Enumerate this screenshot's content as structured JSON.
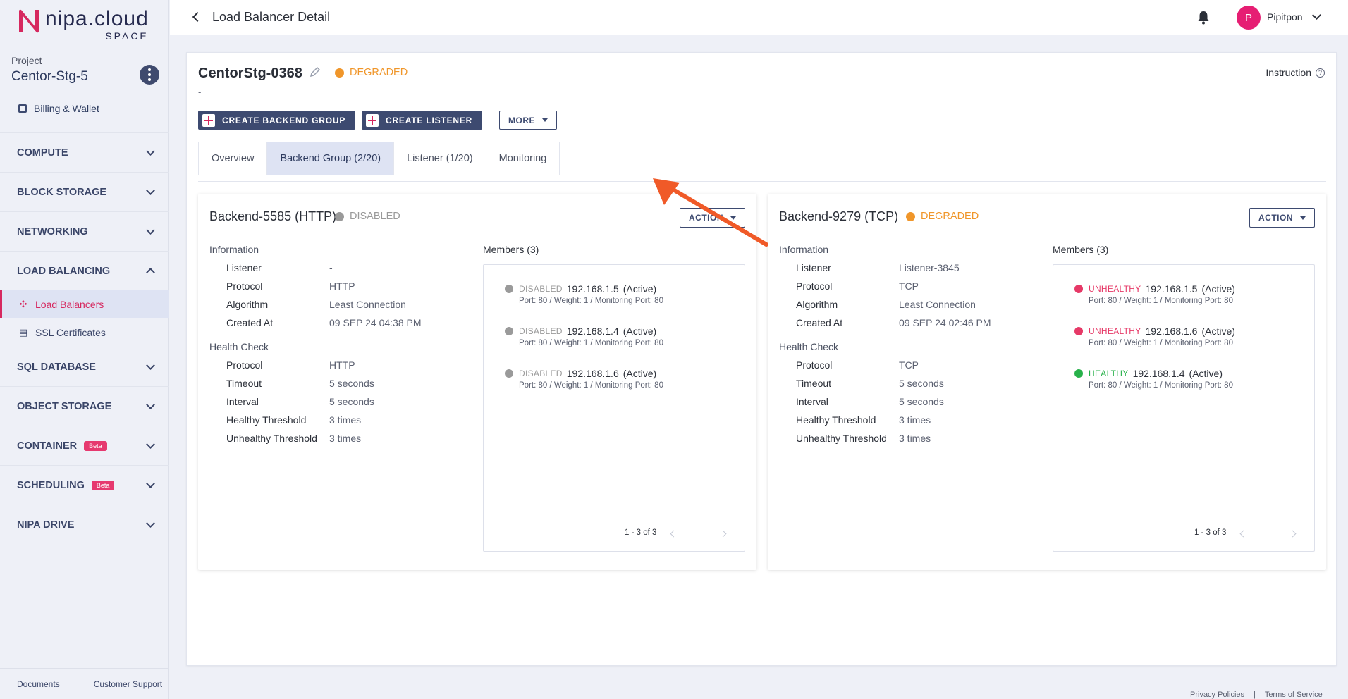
{
  "brand": {
    "name": "nipa.cloud",
    "sub": "SPACE",
    "logo_color": "#d6285f"
  },
  "project": {
    "label": "Project",
    "name": "Centor-Stg-5"
  },
  "billing": "Billing & Wallet",
  "nav": {
    "compute": "COMPUTE",
    "block_storage": "BLOCK STORAGE",
    "networking": "NETWORKING",
    "load_balancing": "LOAD BALANCING",
    "load_balancers": "Load Balancers",
    "ssl_certificates": "SSL Certificates",
    "sql_database": "SQL DATABASE",
    "object_storage": "OBJECT STORAGE",
    "container": "CONTAINER",
    "scheduling": "SCHEDULING",
    "nipa_drive": "NIPA DRIVE",
    "beta": "Beta"
  },
  "side_footer": {
    "documents": "Documents",
    "support": "Customer Support"
  },
  "topbar": {
    "title": "Load Balancer Detail",
    "avatar_letter": "P",
    "user": "Pipitpon"
  },
  "lb": {
    "name": "CentorStg-0368",
    "status": "DEGRADED",
    "description": "-",
    "instruction": "Instruction"
  },
  "buttons": {
    "create_backend": "CREATE BACKEND GROUP",
    "create_listener": "CREATE LISTENER",
    "more": "MORE",
    "action": "ACTION"
  },
  "tabs": [
    "Overview",
    "Backend Group (2/20)",
    "Listener (1/20)",
    "Monitoring"
  ],
  "labels": {
    "information": "Information",
    "listener": "Listener",
    "protocol": "Protocol",
    "algorithm": "Algorithm",
    "created_at": "Created At",
    "health_check": "Health Check",
    "timeout": "Timeout",
    "interval": "Interval",
    "healthy_threshold": "Healthy Threshold",
    "unhealthy_threshold": "Unhealthy Threshold",
    "members": "Members (3)"
  },
  "colors": {
    "degraded": "#f0962a",
    "disabled": "#9a9a9a",
    "unhealthy": "#e63967",
    "healthy": "#27b14a"
  },
  "backends": [
    {
      "title": "Backend-5585 (HTTP)",
      "status": "DISABLED",
      "listener": "-",
      "protocol": "HTTP",
      "algorithm": "Least Connection",
      "created_at": "09 SEP 24 04:38 PM",
      "hc_protocol": "HTTP",
      "timeout": "5 seconds",
      "interval": "5 seconds",
      "healthy": "3 times",
      "unhealthy": "3 times",
      "members": [
        {
          "status": "DISABLED",
          "ip": "192.168.1.5",
          "state": "(Active)",
          "detail": "Port: 80 / Weight: 1 / Monitoring Port: 80"
        },
        {
          "status": "DISABLED",
          "ip": "192.168.1.4",
          "state": "(Active)",
          "detail": "Port: 80 / Weight: 1 / Monitoring Port: 80"
        },
        {
          "status": "DISABLED",
          "ip": "192.168.1.6",
          "state": "(Active)",
          "detail": "Port: 80 / Weight: 1 / Monitoring Port: 80"
        }
      ],
      "pager": "1 - 3 of 3"
    },
    {
      "title": "Backend-9279 (TCP)",
      "status": "DEGRADED",
      "listener": "Listener-3845",
      "protocol": "TCP",
      "algorithm": "Least Connection",
      "created_at": "09 SEP 24 02:46 PM",
      "hc_protocol": "TCP",
      "timeout": "5 seconds",
      "interval": "5 seconds",
      "healthy": "3 times",
      "unhealthy": "3 times",
      "members": [
        {
          "status": "UNHEALTHY",
          "ip": "192.168.1.5",
          "state": "(Active)",
          "detail": "Port: 80 / Weight: 1 / Monitoring Port: 80"
        },
        {
          "status": "UNHEALTHY",
          "ip": "192.168.1.6",
          "state": "(Active)",
          "detail": "Port: 80 / Weight: 1 / Monitoring Port: 80"
        },
        {
          "status": "HEALTHY",
          "ip": "192.168.1.4",
          "state": "(Active)",
          "detail": "Port: 80 / Weight: 1 / Monitoring Port: 80"
        }
      ],
      "pager": "1 - 3 of 3"
    }
  ],
  "page_footer": {
    "privacy": "Privacy Policies",
    "terms": "Terms of Service"
  }
}
